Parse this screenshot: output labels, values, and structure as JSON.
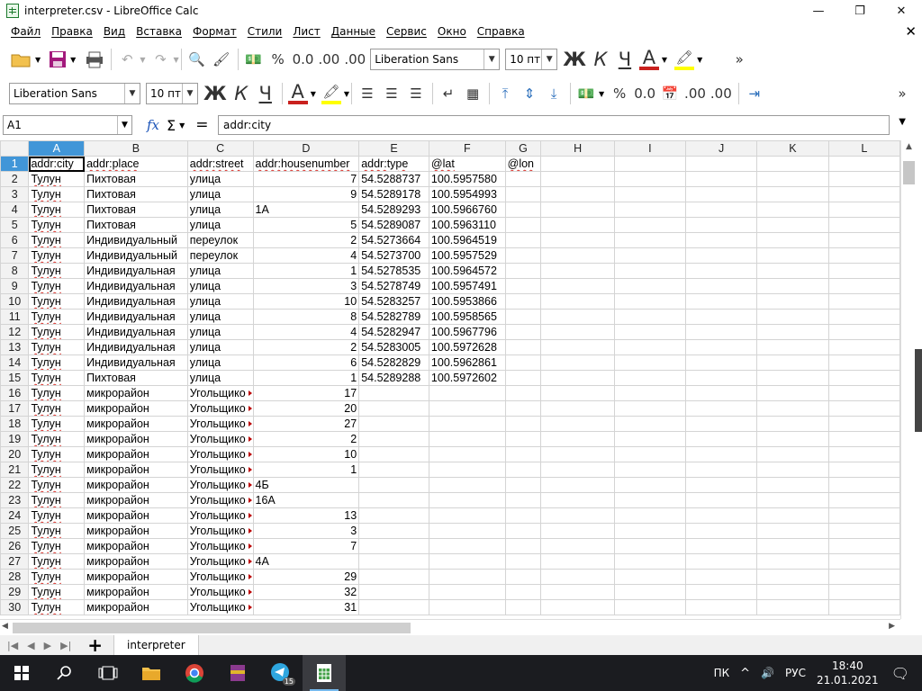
{
  "window": {
    "title": "interpreter.csv - LibreOffice Calc",
    "min": "—",
    "max": "❐",
    "close": "✕"
  },
  "menu": [
    "Файл",
    "Правка",
    "Вид",
    "Вставка",
    "Формат",
    "Стили",
    "Лист",
    "Данные",
    "Сервис",
    "Окно",
    "Справка"
  ],
  "toolbar1": {
    "font_name": "Liberation Sans",
    "font_size": "10 пт",
    "percent": "%",
    "decimals": "0.0",
    "add_decimal": ".00",
    "del_decimal": ".00",
    "bold": "Ж",
    "italic": "К",
    "underline": "Ч",
    "font_color": "A",
    "more": "»"
  },
  "toolbar2": {
    "font_name": "Liberation Sans",
    "font_size": "10 пт",
    "bold": "Ж",
    "italic": "К",
    "underline": "Ч",
    "font_color": "A",
    "percent": "%",
    "decimals": "0.0",
    "add_decimal": ".00",
    "del_decimal": ".00"
  },
  "formula_bar": {
    "cell_ref": "A1",
    "content": "addr:city"
  },
  "grid": {
    "columns": [
      "A",
      "B",
      "C",
      "D",
      "E",
      "F",
      "G",
      "H",
      "I",
      "J",
      "K",
      "L"
    ],
    "rows": [
      {
        "n": "1",
        "a": "addr:city",
        "b": "addr:place",
        "c": "addr:street",
        "d": "addr:housenumber",
        "e": "addr:type",
        "f": "@lat",
        "g": "@lon"
      },
      {
        "n": "2",
        "a": "Тулун",
        "b": "Пихтовая",
        "c": "улица",
        "d": "7",
        "e": "54.5288737",
        "f": "100.5957580"
      },
      {
        "n": "3",
        "a": "Тулун",
        "b": "Пихтовая",
        "c": "улица",
        "d": "9",
        "e": "54.5289178",
        "f": "100.5954993"
      },
      {
        "n": "4",
        "a": "Тулун",
        "b": "Пихтовая",
        "c": "улица",
        "d": "1А",
        "e": "54.5289293",
        "f": "100.5966760"
      },
      {
        "n": "5",
        "a": "Тулун",
        "b": "Пихтовая",
        "c": "улица",
        "d": "5",
        "e": "54.5289087",
        "f": "100.5963110"
      },
      {
        "n": "6",
        "a": "Тулун",
        "b": "Индивидуальный",
        "c": "переулок",
        "d": "2",
        "e": "54.5273664",
        "f": "100.5964519"
      },
      {
        "n": "7",
        "a": "Тулун",
        "b": "Индивидуальный",
        "c": "переулок",
        "d": "4",
        "e": "54.5273700",
        "f": "100.5957529"
      },
      {
        "n": "8",
        "a": "Тулун",
        "b": "Индивидуальная",
        "c": "улица",
        "d": "1",
        "e": "54.5278535",
        "f": "100.5964572"
      },
      {
        "n": "9",
        "a": "Тулун",
        "b": "Индивидуальная",
        "c": "улица",
        "d": "3",
        "e": "54.5278749",
        "f": "100.5957491"
      },
      {
        "n": "10",
        "a": "Тулун",
        "b": "Индивидуальная",
        "c": "улица",
        "d": "10",
        "e": "54.5283257",
        "f": "100.5953866"
      },
      {
        "n": "11",
        "a": "Тулун",
        "b": "Индивидуальная",
        "c": "улица",
        "d": "8",
        "e": "54.5282789",
        "f": "100.5958565"
      },
      {
        "n": "12",
        "a": "Тулун",
        "b": "Индивидуальная",
        "c": "улица",
        "d": "4",
        "e": "54.5282947",
        "f": "100.5967796"
      },
      {
        "n": "13",
        "a": "Тулун",
        "b": "Индивидуальная",
        "c": "улица",
        "d": "2",
        "e": "54.5283005",
        "f": "100.5972628"
      },
      {
        "n": "14",
        "a": "Тулун",
        "b": "Индивидуальная",
        "c": "улица",
        "d": "6",
        "e": "54.5282829",
        "f": "100.5962861"
      },
      {
        "n": "15",
        "a": "Тулун",
        "b": "Пихтовая",
        "c": "улица",
        "d": "1",
        "e": "54.5289288",
        "f": "100.5972602"
      },
      {
        "n": "16",
        "a": "Тулун",
        "b": "микрорайон",
        "c": "Угольщико",
        "d": "17"
      },
      {
        "n": "17",
        "a": "Тулун",
        "b": "микрорайон",
        "c": "Угольщико",
        "d": "20"
      },
      {
        "n": "18",
        "a": "Тулун",
        "b": "микрорайон",
        "c": "Угольщико",
        "d": "27"
      },
      {
        "n": "19",
        "a": "Тулун",
        "b": "микрорайон",
        "c": "Угольщико",
        "d": "2"
      },
      {
        "n": "20",
        "a": "Тулун",
        "b": "микрорайон",
        "c": "Угольщико",
        "d": "10"
      },
      {
        "n": "21",
        "a": "Тулун",
        "b": "микрорайон",
        "c": "Угольщико",
        "d": "1"
      },
      {
        "n": "22",
        "a": "Тулун",
        "b": "микрорайон",
        "c": "Угольщико",
        "d": "4Б"
      },
      {
        "n": "23",
        "a": "Тулун",
        "b": "микрорайон",
        "c": "Угольщико",
        "d": "16А"
      },
      {
        "n": "24",
        "a": "Тулун",
        "b": "микрорайон",
        "c": "Угольщико",
        "d": "13"
      },
      {
        "n": "25",
        "a": "Тулун",
        "b": "микрорайон",
        "c": "Угольщико",
        "d": "3"
      },
      {
        "n": "26",
        "a": "Тулун",
        "b": "микрорайон",
        "c": "Угольщико",
        "d": "7"
      },
      {
        "n": "27",
        "a": "Тулун",
        "b": "микрорайон",
        "c": "Угольщико",
        "d": "4А"
      },
      {
        "n": "28",
        "a": "Тулун",
        "b": "микрорайон",
        "c": "Угольщико",
        "d": "29"
      },
      {
        "n": "29",
        "a": "Тулун",
        "b": "микрорайон",
        "c": "Угольщико",
        "d": "32"
      },
      {
        "n": "30",
        "a": "Тулун",
        "b": "микрорайон",
        "c": "Угольщико",
        "d": "31"
      }
    ]
  },
  "sheets": {
    "active": "interpreter",
    "add": "+"
  },
  "taskbar": {
    "tray_lang_short": "ПК",
    "tray_lang": "РУС",
    "time": "18:40",
    "date": "21.01.2021",
    "badge": "15"
  },
  "colors": {
    "selected_header": "#4196d8",
    "spell_underline": "#d9312b",
    "font_color_bar": "#c9211e",
    "highlight_bar": "#ffff00"
  }
}
